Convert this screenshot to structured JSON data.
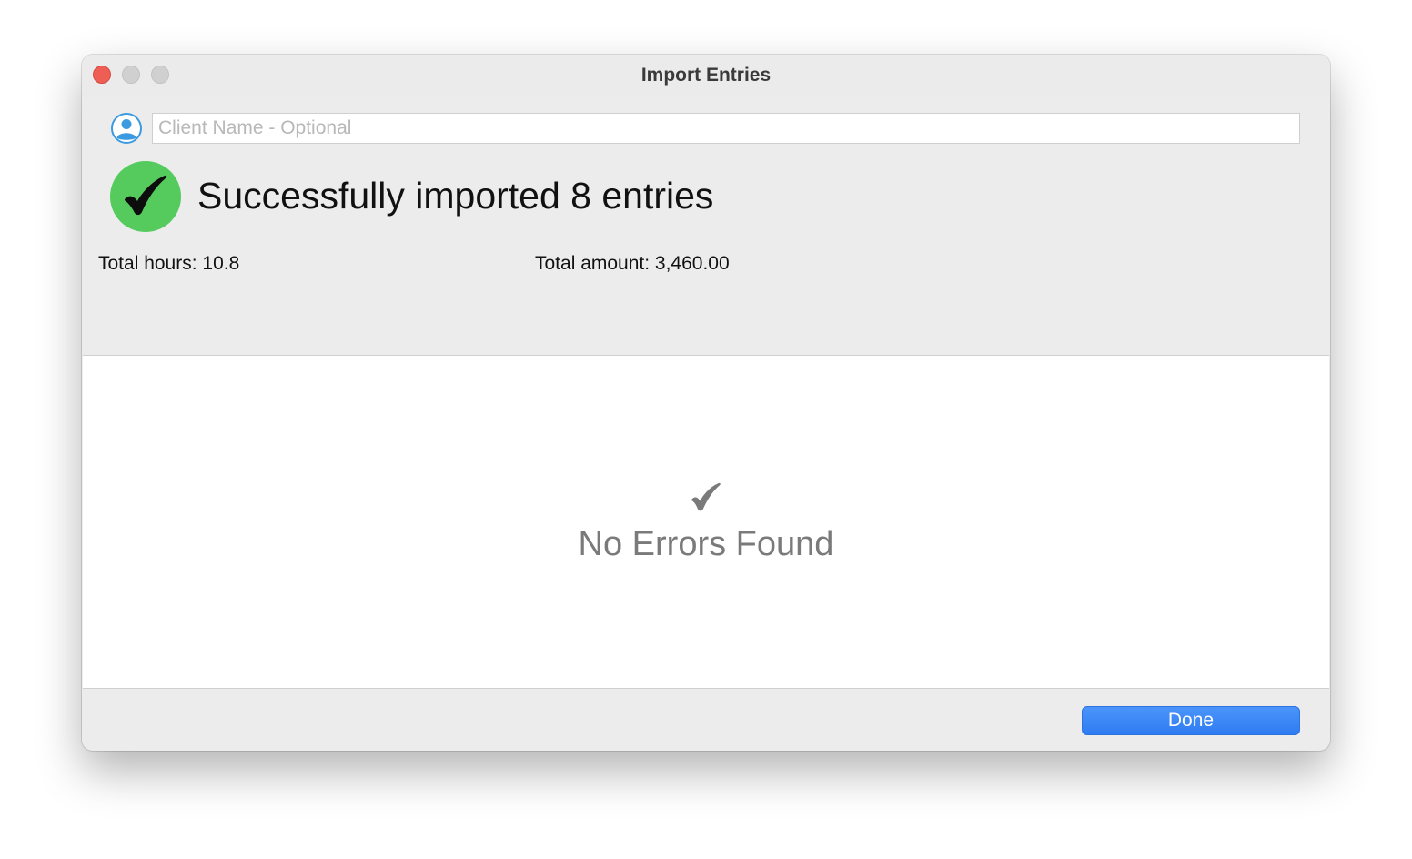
{
  "window": {
    "title": "Import Entries"
  },
  "client": {
    "placeholder": "Client Name - Optional",
    "value": "",
    "icon": "person-circle-icon"
  },
  "result": {
    "status_icon": "success-checkmark-icon",
    "status_color": "#54cb5c",
    "message": "Successfully imported 8 entries",
    "total_hours_text": "Total hours: 10.8",
    "total_amount_text": "Total amount: 3,460.00"
  },
  "errors": {
    "icon": "checkmark-icon",
    "message": "No Errors Found"
  },
  "footer": {
    "done_label": "Done",
    "accent_color": "#3484f6"
  }
}
